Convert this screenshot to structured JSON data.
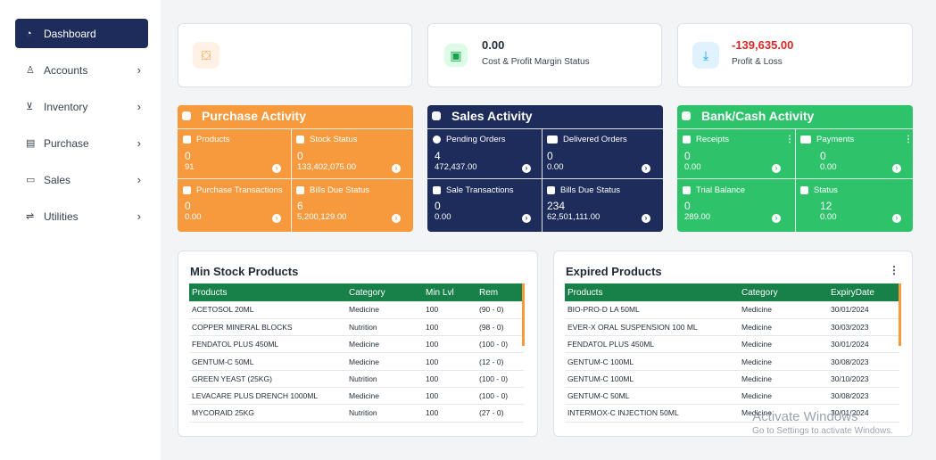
{
  "sidebar": {
    "items": [
      {
        "label": "Dashboard",
        "icon": "dashboard-icon",
        "active": true
      },
      {
        "label": "Accounts",
        "icon": "user-icon"
      },
      {
        "label": "Inventory",
        "icon": "cart-icon"
      },
      {
        "label": "Purchase",
        "icon": "receipt-icon"
      },
      {
        "label": "Sales",
        "icon": "calendar-icon"
      },
      {
        "label": "Utilities",
        "icon": "exchange-icon"
      }
    ]
  },
  "top_cards": {
    "card1": {
      "value": "",
      "label": "",
      "icon": "shopping-bag-icon"
    },
    "card2": {
      "value": "0.00",
      "label": "Cost & Profit Margin Status",
      "icon": "money-icon"
    },
    "card3": {
      "value": "-139,635.00",
      "label": "Profit & Loss",
      "icon": "download-icon",
      "value_color": "#dc2626"
    }
  },
  "purchase": {
    "title": "Purchase Activity",
    "products": {
      "label": "Products",
      "count": "0",
      "amount": "91"
    },
    "stock": {
      "label": "Stock Status",
      "count": "0",
      "amount": "133,402,075.00"
    },
    "transactions": {
      "label": "Purchase Transactions",
      "count": "0",
      "amount": "0.00"
    },
    "bills": {
      "label": "Bills Due Status",
      "count": "6",
      "amount": "5,200,129.00"
    }
  },
  "sales": {
    "title": "Sales Activity",
    "pending": {
      "label": "Pending Orders",
      "count": "4",
      "amount": "472,437.00"
    },
    "delivered": {
      "label": "Delivered Orders",
      "count": "0",
      "amount": "0.00"
    },
    "transactions": {
      "label": "Sale Transactions",
      "count": "0",
      "amount": "0.00"
    },
    "bills": {
      "label": "Bills Due Status",
      "count": "234",
      "amount": "62,501,111.00"
    }
  },
  "bank": {
    "title": "Bank/Cash Activity",
    "receipts": {
      "label": "Receipts",
      "count": "0",
      "amount": "0.00"
    },
    "payments": {
      "label": "Payments",
      "count": "0",
      "amount": "0.00"
    },
    "trial": {
      "label": "Trial Balance",
      "count": "0",
      "amount": "289.00"
    },
    "status": {
      "label": "Status",
      "count": "12",
      "amount": "0.00"
    }
  },
  "min_stock": {
    "title": "Min Stock Products",
    "headers": [
      "Products",
      "Category",
      "Min Lvl",
      "Rem"
    ],
    "rows": [
      [
        "ACETOSOL 20ML",
        "Medicine",
        "100",
        "(90 - 0)"
      ],
      [
        "COPPER MINERAL BLOCKS",
        "Nutrition",
        "100",
        "(98 - 0)"
      ],
      [
        "FENDATOL PLUS 450ML",
        "Medicine",
        "100",
        "(100 - 0)"
      ],
      [
        "GENTUM-C 50ML",
        "Medicine",
        "100",
        "(12 - 0)"
      ],
      [
        "GREEN YEAST (25KG)",
        "Nutrition",
        "100",
        "(100 - 0)"
      ],
      [
        "LEVACARE PLUS DRENCH 1000ML",
        "Medicine",
        "100",
        "(100 - 0)"
      ],
      [
        "MYCORAID 25KG",
        "Nutrition",
        "100",
        "(27 - 0)"
      ]
    ]
  },
  "expired": {
    "title": "Expired Products",
    "menu": "⋮",
    "headers": [
      "Products",
      "Category",
      "ExpiryDate"
    ],
    "rows": [
      [
        "BIO-PRO-D LA 50ML",
        "Medicine",
        "30/01/2024"
      ],
      [
        "EVER-X ORAL SUSPENSION 100 ML",
        "Medicine",
        "30/03/2023"
      ],
      [
        "FENDATOL PLUS 450ML",
        "Medicine",
        "30/01/2024"
      ],
      [
        "GENTUM-C 100ML",
        "Medicine",
        "30/08/2023"
      ],
      [
        "GENTUM-C 100ML",
        "Medicine",
        "30/10/2023"
      ],
      [
        "GENTUM-C 50ML",
        "Medicine",
        "30/08/2023"
      ],
      [
        "INTERMOX-C INJECTION 50ML",
        "Medicine",
        "30/01/2024"
      ]
    ]
  },
  "watermark": {
    "line1": "Activate Windows",
    "line2": "Go to Settings to activate Windows."
  }
}
